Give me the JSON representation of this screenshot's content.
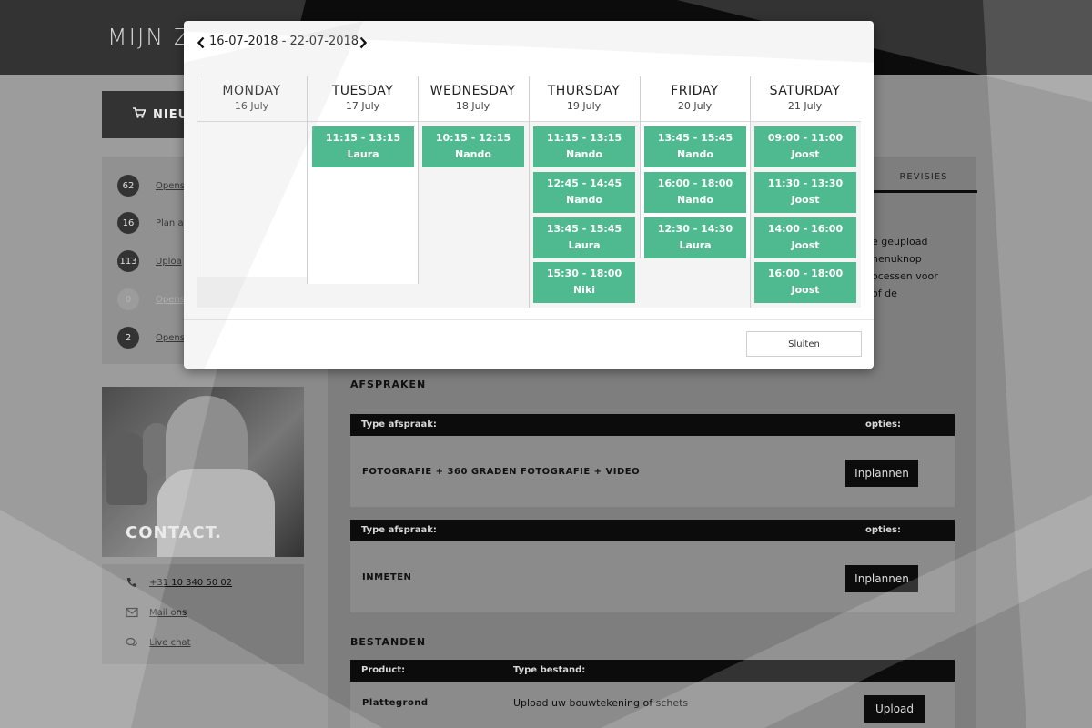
{
  "app": {
    "logo_text": "MIJN Z"
  },
  "sidebar": {
    "new_button_label": "NIEUW",
    "items": [
      {
        "count": "62",
        "label": "Opens"
      },
      {
        "count": "16",
        "label": "Plan af"
      },
      {
        "count": "113",
        "label": "Uploa"
      },
      {
        "count": "0",
        "label": "Opens"
      },
      {
        "count": "2",
        "label": "Opens"
      }
    ],
    "contact_title": "CONTACT.",
    "contact_links": [
      {
        "icon": "phone-icon",
        "label": "+31 10 340 50 02"
      },
      {
        "icon": "mail-icon",
        "label": "Mail ons"
      },
      {
        "icon": "chat-icon",
        "label": "Live chat"
      }
    ]
  },
  "main": {
    "revisies_tab": "REVISIES",
    "intro_lines": [
      "e geupload",
      "nenuknop",
      "ocessen voor",
      "of de"
    ],
    "afspraken": {
      "title": "AFSPRAKEN",
      "tables": [
        {
          "col_type": "Type afspraak:",
          "col_options": "opties:",
          "row_label": "FOTOGRAFIE + 360 GRADEN FOTOGRAFIE + VIDEO",
          "button": "Inplannen"
        },
        {
          "col_type": "Type afspraak:",
          "col_options": "opties:",
          "row_label": "INMETEN",
          "button": "Inplannen"
        }
      ]
    },
    "bestanden": {
      "title": "BESTANDEN",
      "col_product": "Product:",
      "col_type": "Type bestand:",
      "row_product": "Plattegrond",
      "row_type": "Upload uw bouwtekening of schets",
      "button": "Upload"
    }
  },
  "modal": {
    "date_from": "16-07-2018",
    "date_sep": " - ",
    "date_to": "22-07-2018",
    "close_label": "Sluiten",
    "days": [
      {
        "name": "MONDAY",
        "date": "16 July",
        "slots": []
      },
      {
        "name": "TUESDAY",
        "date": "17 July",
        "slots": [
          {
            "time": "11:15 - 13:15",
            "person": "Laura"
          }
        ]
      },
      {
        "name": "WEDNESDAY",
        "date": "18 July",
        "slots": [
          {
            "time": "10:15 - 12:15",
            "person": "Nando"
          }
        ]
      },
      {
        "name": "THURSDAY",
        "date": "19 July",
        "slots": [
          {
            "time": "11:15 - 13:15",
            "person": "Nando"
          },
          {
            "time": "12:45 - 14:45",
            "person": "Nando"
          },
          {
            "time": "13:45 - 15:45",
            "person": "Laura"
          },
          {
            "time": "15:30 - 18:00",
            "person": "Niki"
          }
        ]
      },
      {
        "name": "FRIDAY",
        "date": "20 July",
        "slots": [
          {
            "time": "13:45 - 15:45",
            "person": "Nando"
          },
          {
            "time": "16:00 - 18:00",
            "person": "Nando"
          },
          {
            "time": "12:30 - 14:30",
            "person": "Laura"
          }
        ]
      },
      {
        "name": "SATURDAY",
        "date": "21 July",
        "slots": [
          {
            "time": "09:00 - 11:00",
            "person": "Joost"
          },
          {
            "time": "11:30 - 13:30",
            "person": "Joost"
          },
          {
            "time": "14:00 - 16:00",
            "person": "Joost"
          },
          {
            "time": "16:00 - 18:00",
            "person": "Joost"
          }
        ]
      }
    ]
  },
  "colors": {
    "slot_green": "#4fba8f",
    "dark": "#0c0c0c",
    "overlay_gray": "#8a8a8a"
  }
}
